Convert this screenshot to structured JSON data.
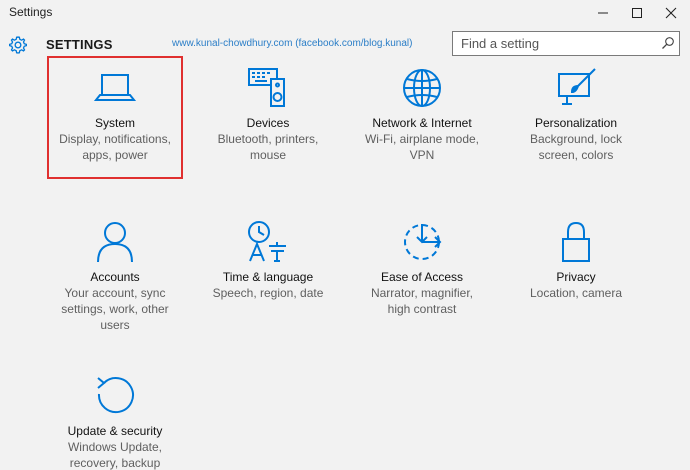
{
  "window": {
    "title": "Settings",
    "controls": [
      "minimize",
      "maximize",
      "close"
    ]
  },
  "header": {
    "heading": "SETTINGS",
    "watermark": "www.kunal-chowdhury.com (facebook.com/blog.kunal)"
  },
  "search": {
    "placeholder": "Find a setting",
    "value": ""
  },
  "categories": [
    {
      "name": "System",
      "description": "Display, notifications,\napps, power",
      "icon": "laptop-icon",
      "selected": true
    },
    {
      "name": "Devices",
      "description": "Bluetooth, printers,\nmouse",
      "icon": "devices-icon",
      "selected": false
    },
    {
      "name": "Network & Internet",
      "description": "Wi-Fi, airplane mode,\nVPN",
      "icon": "globe-icon",
      "selected": false
    },
    {
      "name": "Personalization",
      "description": "Background, lock\nscreen, colors",
      "icon": "paintbrush-icon",
      "selected": false
    },
    {
      "name": "Accounts",
      "description": "Your account, sync\nsettings, work, other\nusers",
      "icon": "person-icon",
      "selected": false
    },
    {
      "name": "Time & language",
      "description": "Speech, region, date",
      "icon": "time-language-icon",
      "selected": false
    },
    {
      "name": "Ease of Access",
      "description": "Narrator, magnifier,\nhigh contrast",
      "icon": "ease-of-access-icon",
      "selected": false
    },
    {
      "name": "Privacy",
      "description": "Location, camera",
      "icon": "lock-icon",
      "selected": false
    },
    {
      "name": "Update & security",
      "description": "Windows Update,\nrecovery, backup",
      "icon": "refresh-icon",
      "selected": false
    }
  ],
  "colors": {
    "accent": "#0078d7",
    "selection_border": "#e0302f",
    "background": "#f2f2f2"
  }
}
